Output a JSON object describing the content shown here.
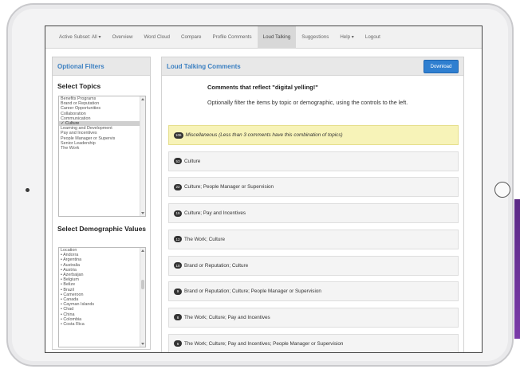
{
  "nav": {
    "items": [
      {
        "label": "Active Subset: All ▾"
      },
      {
        "label": "Overview"
      },
      {
        "label": "Word Cloud"
      },
      {
        "label": "Compare"
      },
      {
        "label": "Profile Comments"
      },
      {
        "label": "Loud Talking"
      },
      {
        "label": "Suggestions"
      },
      {
        "label": "Help ▾"
      },
      {
        "label": "Logout"
      }
    ],
    "active": "Loud Talking"
  },
  "filters": {
    "header": "Optional Filters",
    "topics_label": "Select Topics",
    "topics": [
      "Benefits Programs",
      "Brand or Reputation",
      "Career Opportunities",
      "Collaboration",
      "Communication",
      "✓ Culture",
      "Learning and Development",
      "Pay and Incentives",
      "People Manager or Supervis",
      "Senior Leadership",
      "The Work"
    ],
    "topics_selected_index": 5,
    "demo_label": "Select Demographic Values",
    "demographics": [
      "Location",
      "• Andorra",
      "• Argentina",
      "• Australia",
      "• Austria",
      "• Azerbaijan",
      "• Belgium",
      "• Belize",
      "• Brazil",
      "• Cameroon",
      "• Canada",
      "• Cayman Islands",
      "• Chad",
      "• China",
      "• Colombia",
      "• Costa Rica"
    ]
  },
  "main": {
    "title": "Loud Talking Comments",
    "download_label": "Download",
    "desc_title": "Comments that reflect \"digital yelling!\"",
    "desc_text": "Optionally filter the items by topic or demographic, using the controls to the left.",
    "rows": [
      {
        "count": "106",
        "label": "Miscellaneous (Less than 3 comments have this combination of topics)",
        "highlight": true
      },
      {
        "count": "53",
        "label": "Culture",
        "highlight": false
      },
      {
        "count": "22",
        "label": "Culture; People Manager or Supervision",
        "highlight": false
      },
      {
        "count": "15",
        "label": "Culture; Pay and Incentives",
        "highlight": false
      },
      {
        "count": "12",
        "label": "The Work; Culture",
        "highlight": false
      },
      {
        "count": "10",
        "label": "Brand or Reputation; Culture",
        "highlight": false
      },
      {
        "count": "9",
        "label": "Brand or Reputation; Culture; People Manager or Supervision",
        "highlight": false
      },
      {
        "count": "8",
        "label": "The Work; Culture; Pay and Incentives",
        "highlight": false
      },
      {
        "count": "6",
        "label": "The Work; Culture; Pay and Incentives; People Manager or Supervision",
        "highlight": false
      }
    ]
  }
}
